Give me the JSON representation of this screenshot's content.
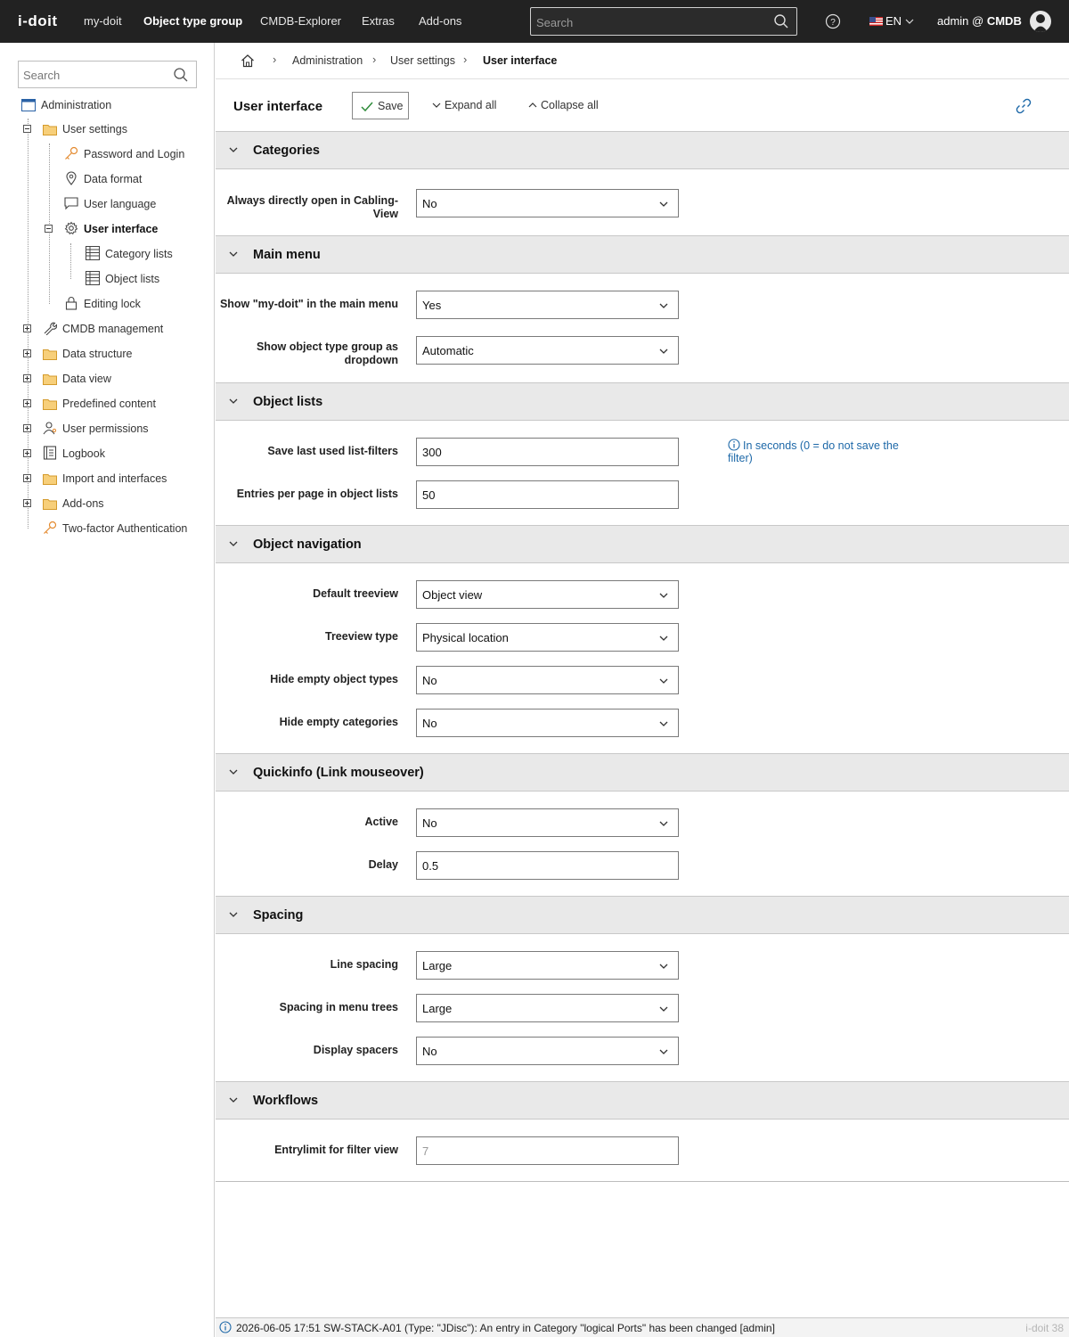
{
  "topbar": {
    "logo": "i-doit",
    "nav": [
      "my-doit",
      "Object type group",
      "CMDB-Explorer",
      "Extras",
      "Add-ons"
    ],
    "search_placeholder": "Search",
    "language": "EN",
    "user_prefix": "admin @",
    "user_db": "CMDB"
  },
  "sidebar": {
    "search_placeholder": "Search",
    "tree": {
      "administration": "Administration",
      "user_settings": "User settings",
      "password_login": "Password and Login",
      "data_format": "Data format",
      "user_language": "User language",
      "user_interface": "User interface",
      "category_lists": "Category lists",
      "object_lists": "Object lists",
      "editing_lock": "Editing lock",
      "cmdb_management": "CMDB management",
      "data_structure": "Data structure",
      "data_view": "Data view",
      "predefined_content": "Predefined content",
      "user_permissions": "User permissions",
      "logbook": "Logbook",
      "import_interfaces": "Import and interfaces",
      "add_ons": "Add-ons",
      "two_factor": "Two-factor Authentication"
    }
  },
  "breadcrumb": [
    "Administration",
    "User settings",
    "User interface"
  ],
  "toolbar": {
    "title": "User interface",
    "save": "Save",
    "expand_all": "Expand all",
    "collapse_all": "Collapse all"
  },
  "sections": {
    "categories": {
      "title": "Categories",
      "cabling_label": "Always directly open in Cabling-View",
      "cabling_value": "No"
    },
    "main_menu": {
      "title": "Main menu",
      "mydoit_label": "Show \"my-doit\" in the main menu",
      "mydoit_value": "Yes",
      "otg_label": "Show object type group as dropdown",
      "otg_value": "Automatic"
    },
    "object_lists": {
      "title": "Object lists",
      "filters_label": "Save last used list-filters",
      "filters_value": "300",
      "filters_hint": "In seconds (0 = do not save the filter)",
      "entries_label": "Entries per page in object lists",
      "entries_value": "50"
    },
    "object_navigation": {
      "title": "Object navigation",
      "treeview_label": "Default treeview",
      "treeview_value": "Object view",
      "treetype_label": "Treeview type",
      "treetype_value": "Physical location",
      "hide_types_label": "Hide empty object types",
      "hide_types_value": "No",
      "hide_cats_label": "Hide empty categories",
      "hide_cats_value": "No"
    },
    "quickinfo": {
      "title": "Quickinfo (Link mouseover)",
      "active_label": "Active",
      "active_value": "No",
      "delay_label": "Delay",
      "delay_value": "0.5"
    },
    "spacing": {
      "title": "Spacing",
      "line_label": "Line spacing",
      "line_value": "Large",
      "menu_label": "Spacing in menu trees",
      "menu_value": "Large",
      "spacers_label": "Display spacers",
      "spacers_value": "No"
    },
    "workflows": {
      "title": "Workflows",
      "limit_label": "Entrylimit for filter view",
      "limit_placeholder": "7"
    }
  },
  "statusbar": {
    "message": "2026-06-05 17:51 SW-STACK-A01 (Type: \"JDisc\"): An entry in Category \"logical Ports\" has been changed [admin]",
    "version": "i-doit 38"
  },
  "colors": {
    "topbar_bg": "#222222",
    "section_bg": "#e9e9e9",
    "hint_blue": "#1d68a8",
    "accent_green": "#2e8b3a"
  }
}
